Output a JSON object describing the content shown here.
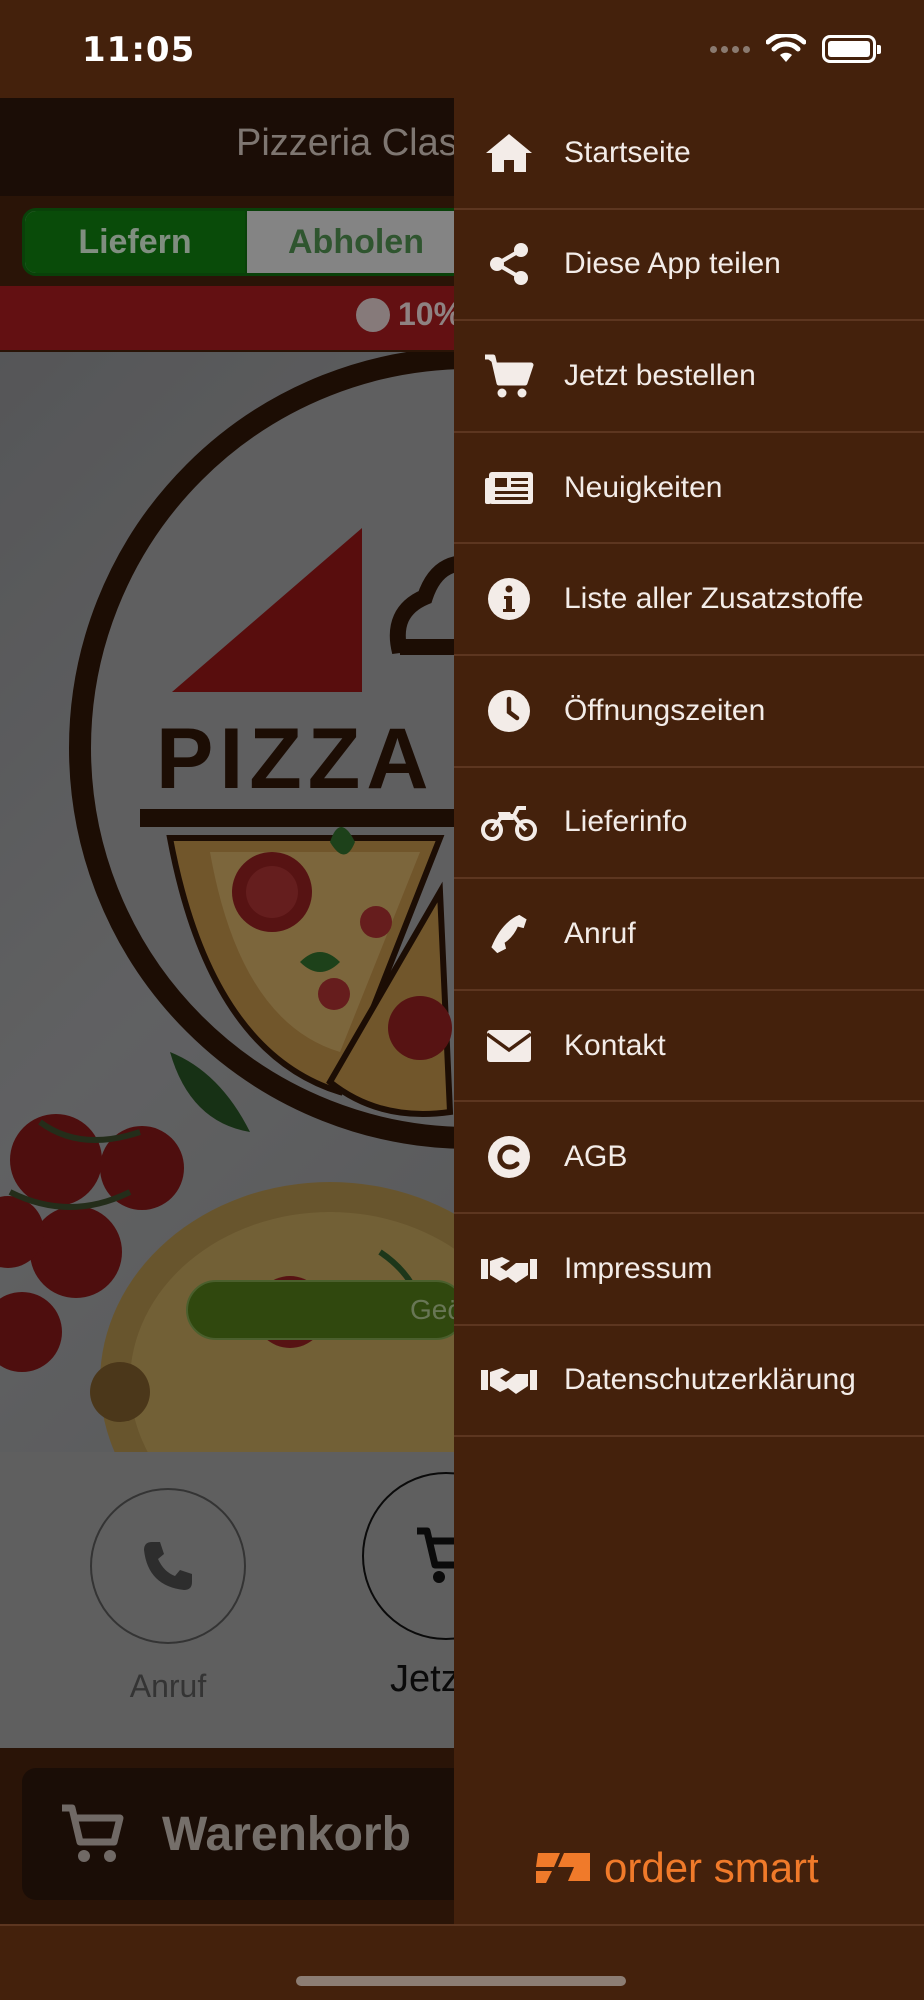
{
  "status_bar": {
    "time": "11:05",
    "icons": [
      "signal-icon",
      "wifi-icon",
      "battery-icon"
    ]
  },
  "main": {
    "title": "Pizzeria Class",
    "mode_toggle": {
      "deliver": "Liefern",
      "pickup": "Abholen",
      "selected": "Liefern"
    },
    "promo": {
      "text": "10%"
    },
    "hero": {
      "logo_text": "PIZZA C",
      "open_badge": "Geö"
    },
    "actions": [
      {
        "label": "Anruf",
        "icon": "phone-icon"
      },
      {
        "label": "Jetzt b",
        "icon": "cart-icon"
      }
    ],
    "cart": {
      "label": "Warenkorb",
      "icon": "cart-icon"
    }
  },
  "drawer": {
    "items": [
      {
        "label": "Startseite",
        "icon": "home-icon"
      },
      {
        "label": "Diese App teilen",
        "icon": "share-icon"
      },
      {
        "label": "Jetzt bestellen",
        "icon": "cart-icon"
      },
      {
        "label": "Neuigkeiten",
        "icon": "newspaper-icon"
      },
      {
        "label": "Liste aller Zusatzstoffe",
        "icon": "info-icon"
      },
      {
        "label": "Öffnungszeiten",
        "icon": "clock-icon"
      },
      {
        "label": "Lieferinfo",
        "icon": "motorcycle-icon"
      },
      {
        "label": "Anruf",
        "icon": "phone-icon"
      },
      {
        "label": "Kontakt",
        "icon": "envelope-icon"
      },
      {
        "label": "AGB",
        "icon": "copyright-icon"
      },
      {
        "label": "Impressum",
        "icon": "handshake-icon"
      },
      {
        "label": "Datenschutzerklärung",
        "icon": "handshake-icon"
      }
    ],
    "brand": "order smart"
  },
  "colors": {
    "drawer_bg": "#44210c",
    "deliver_green": "#0f7a0f",
    "promo_red": "#a11a1e",
    "open_green": "#5c8a1a",
    "brand_orange": "#f07a2a"
  }
}
